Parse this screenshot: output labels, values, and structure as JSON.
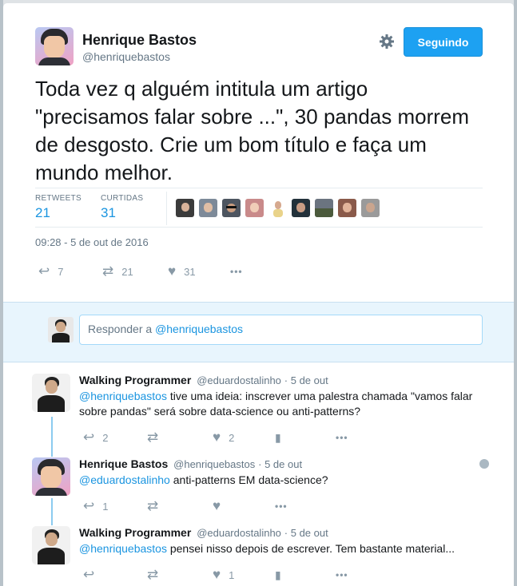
{
  "tweet": {
    "author_name": "Henrique Bastos",
    "author_handle": "@henriquebastos",
    "follow_label": "Seguindo",
    "settings_icon": "gear-icon",
    "text": "Toda vez q alguém intitula um artigo \"precisamos falar sobre ...\", 30 pandas morrem de desgosto. Crie um bom título e faça um mundo melhor.",
    "retweets_label": "RETWEETS",
    "retweets_count": "21",
    "likes_label": "CURTIDAS",
    "likes_count": "31",
    "liker_avatar_count": 9,
    "timestamp": "09:28 - 5 de out de 2016",
    "actions": {
      "reply_count": "7",
      "retweet_count": "21",
      "like_count": "31",
      "more": "•••"
    }
  },
  "reply_box": {
    "prefix": "Responder a ",
    "mention": "@henriquebastos"
  },
  "replies": [
    {
      "name": "Walking Programmer",
      "handle": "@eduardostalinho",
      "time": "· 5 de out",
      "mention": "@henriquebastos",
      "text": " tive uma ideia: inscrever uma palestra chamada \"vamos falar sobre pandas\" será sobre data-science ou anti-patterns?",
      "reply_count": "2",
      "retweet_count": "",
      "like_count": "2",
      "more": "•••"
    },
    {
      "name": "Henrique Bastos",
      "handle": "@henriquebastos",
      "time": "· 5 de out",
      "mention": "@eduardostalinho",
      "text": " anti-patterns EM data-science?",
      "reply_count": "1",
      "retweet_count": "",
      "like_count": "",
      "more": "•••"
    },
    {
      "name": "Walking Programmer",
      "handle": "@eduardostalinho",
      "time": "· 5 de out",
      "mention": "@henriquebastos",
      "text": " pensei nisso depois de escrever. Tem bastante material...",
      "reply_count": "",
      "retweet_count": "",
      "like_count": "1",
      "more": "•••"
    }
  ],
  "colors": {
    "accent": "#1da1f2",
    "link": "#1b95e0",
    "muted": "#657786",
    "reply_bg": "#e8f5fd"
  }
}
